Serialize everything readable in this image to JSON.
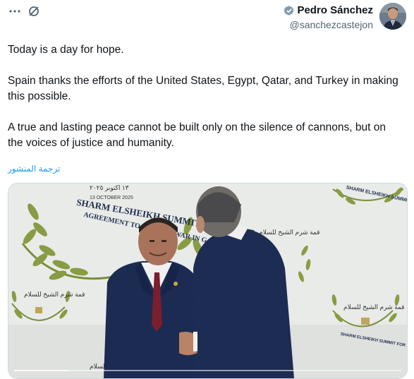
{
  "header": {
    "more_icon": "more-horizontal-icon",
    "noshare_icon": "no-share-icon",
    "author_name": "Pedro Sánchez",
    "author_handle": "@sanchezcastejon",
    "verified_icon": "verified-badge-icon",
    "verified_color": "#829aab"
  },
  "tweet": {
    "text": "Today is a day for hope.\n\nSpain thanks the efforts of the United States, Egypt, Qatar, and Turkey in making this possible.\n\nA true and lasting peace cannot be built only on the silence of cannons, but on the voices of justice and humanity.",
    "translate_link": "ترجمة المنشور"
  },
  "media": {
    "backdrop_title": "SHARM ELSHEIKH SUMMIT FOR PEACE",
    "backdrop_subtitle": "AGREEMENT TO END THE WAR IN GAZA",
    "arabic_date": "١٣ اكتوبر ٢٠٢٥",
    "english_date": "13 OCTOBER 2025",
    "arabic_emblem_text": "قمة شرم الشيخ للسلام",
    "emblem_small_text": "SHARM ELSHEIKH SUMMIT FOR PEACE",
    "progress_fraction": 0.14
  },
  "colors": {
    "link": "#1d9bf0",
    "secondary_text": "#536471",
    "text": "#0f1419"
  }
}
